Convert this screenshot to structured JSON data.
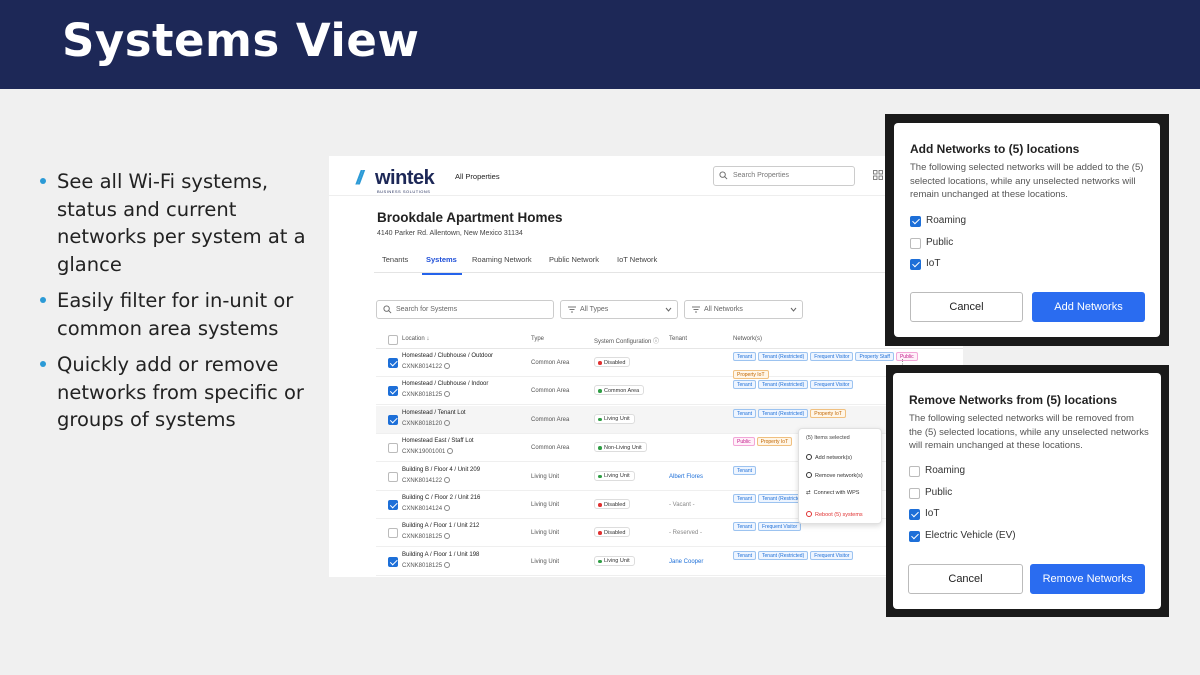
{
  "slide": {
    "title": "Systems View",
    "bullets": [
      "See all Wi-Fi systems, status and current networks per system at a glance",
      "Easily filter for in-unit or common area systems",
      "Quickly add or remove networks from specific or groups of systems"
    ]
  },
  "app": {
    "logo": {
      "mark": "//",
      "word": "wintek",
      "sub": "BUSINESS SOLUTIONS"
    },
    "nav_all_properties": "All Properties",
    "search_properties_placeholder": "Search Properties",
    "property_title": "Brookdale Apartment Homes",
    "property_address": "4140 Parker Rd. Allentown, New Mexico 31134",
    "tabs": [
      "Tenants",
      "Systems",
      "Roaming Network",
      "Public Network",
      "IoT Network"
    ],
    "active_tab": "Systems",
    "filters": {
      "search_placeholder": "Search for Systems",
      "type_placeholder": "All Types",
      "network_placeholder": "All Networks"
    },
    "columns": [
      "Location",
      "Type",
      "System Configuration",
      "Tenant",
      "Network(s)"
    ],
    "rows": [
      {
        "checked": true,
        "location": "Homestead  /  Clubhouse  /  Outdoor",
        "id": "CXNK8014122",
        "type": "Common Area",
        "config": "Disabled",
        "config_color": "#e03131",
        "tenant": "",
        "networks": [
          [
            "Tenant",
            "blue"
          ],
          [
            "Tenant (Restricted)",
            "blue"
          ],
          [
            "Frequent Visitor",
            "blue"
          ],
          [
            "Property Staff",
            "blue"
          ],
          [
            "Public",
            "pink"
          ],
          [
            "Property IoT",
            "orange"
          ]
        ]
      },
      {
        "checked": true,
        "location": "Homestead  /  Clubhouse  /  Indoor",
        "id": "CXNK8018125",
        "type": "Common Area",
        "config": "Common Area",
        "config_color": "#2f9e44",
        "tenant": "",
        "networks": [
          [
            "Tenant",
            "blue"
          ],
          [
            "Tenant (Restricted)",
            "blue"
          ],
          [
            "Frequent Visitor",
            "blue"
          ]
        ]
      },
      {
        "checked": true,
        "location": "Homestead  /  Tenant Lot",
        "id": "CXNK8018120",
        "type": "Common Area",
        "config": "Living Unit",
        "config_color": "#2f9e44",
        "tenant": "",
        "networks": [
          [
            "Tenant",
            "blue"
          ],
          [
            "Tenant (Restricted)",
            "blue"
          ],
          [
            "Property IoT",
            "orange"
          ]
        ]
      },
      {
        "checked": false,
        "location": "Homestead East  /  Staff Lot",
        "id": "CXNK19001001",
        "type": "Common Area",
        "config": "Non-Living Unit",
        "config_color": "#2f9e44",
        "tenant": "",
        "networks": [
          [
            "Public",
            "pink"
          ],
          [
            "Property IoT",
            "orange"
          ]
        ]
      },
      {
        "checked": false,
        "location": "Building B  /  Floor 4  /  Unit 209",
        "id": "CXNK8014122",
        "type": "Living Unit",
        "config": "Living Unit",
        "config_color": "#2f9e44",
        "tenant": "Albert Flores",
        "tenant_link": true,
        "networks": [
          [
            "Tenant",
            "blue"
          ]
        ]
      },
      {
        "checked": true,
        "location": "Building C  /  Floor 2  /  Unit 216",
        "id": "CXNK8014124",
        "type": "Living Unit",
        "config": "Disabled",
        "config_color": "#e03131",
        "tenant": "- Vacant -",
        "tenant_link": false,
        "networks": [
          [
            "Tenant",
            "blue"
          ],
          [
            "Tenant (Restricted)",
            "blue"
          ]
        ]
      },
      {
        "checked": false,
        "location": "Building A  /  Floor 1  /  Unit 212",
        "id": "CXNK8018125",
        "type": "Living Unit",
        "config": "Disabled",
        "config_color": "#e03131",
        "tenant": "- Reserved -",
        "tenant_link": false,
        "networks": [
          [
            "Tenant",
            "blue"
          ],
          [
            "Frequent Visitor",
            "blue"
          ]
        ]
      },
      {
        "checked": true,
        "location": "Building A  /  Floor 1  /  Unit 198",
        "id": "CXNK8018125",
        "type": "Living Unit",
        "config": "Living Unit",
        "config_color": "#2f9e44",
        "tenant": "Jane Cooper",
        "tenant_link": true,
        "networks": [
          [
            "Tenant",
            "blue"
          ],
          [
            "Tenant (Restricted)",
            "blue"
          ],
          [
            "Frequent Visitor",
            "blue"
          ]
        ]
      }
    ],
    "context_menu": {
      "header": "(5) Items selected",
      "items": [
        "Add network(s)",
        "Remove network(s)",
        "Connect with WPS",
        "Reboot (5) systems"
      ]
    }
  },
  "add_modal": {
    "title": "Add Networks to (5) locations",
    "description": "The following selected networks will be added to the (5) selected locations, while any unselected networks will remain unchanged at these locations.",
    "options": [
      {
        "label": "Roaming",
        "checked": true
      },
      {
        "label": "Public",
        "checked": false
      },
      {
        "label": "IoT",
        "checked": true
      }
    ],
    "cancel_label": "Cancel",
    "confirm_label": "Add Networks"
  },
  "remove_modal": {
    "title": "Remove Networks from (5) locations",
    "description": "The following selected networks will be removed from the (5) selected locations, while any unselected networks will remain unchanged at these locations.",
    "options": [
      {
        "label": "Roaming",
        "checked": false
      },
      {
        "label": "Public",
        "checked": false
      },
      {
        "label": "IoT",
        "checked": true
      },
      {
        "label": "Electric Vehicle (EV)",
        "checked": true
      }
    ],
    "cancel_label": "Cancel",
    "confirm_label": "Remove Networks"
  },
  "colors": {
    "banner": "#1d2857",
    "accent": "#2a6cf0",
    "bullet": "#2b9ad6"
  }
}
